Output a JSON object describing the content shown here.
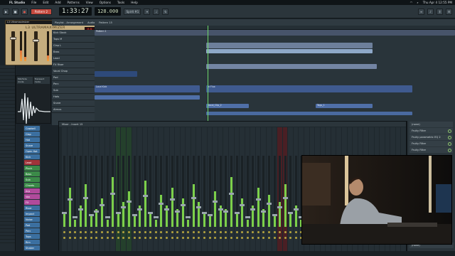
{
  "menubar": {
    "app": "FL Studio",
    "items": [
      "File",
      "Edit",
      "Add",
      "Patterns",
      "View",
      "Options",
      "Tools",
      "Help"
    ],
    "clock": "Thu Apr 4 12:55 PM"
  },
  "toolbar": {
    "pattern_label": "Pattern 2",
    "time": "1:33:27",
    "tempo": "128.000",
    "preset_box": "Spirit #1",
    "colors": {
      "pattern": "#c44a3f",
      "lcd": "#0b1012"
    }
  },
  "plugin": {
    "window_title": "L3 Ultramaximizer",
    "brand": "L3 ULTRAMAXIMIZER",
    "red_display": "0.0",
    "buttons": [
      "ARC",
      "Type",
      "Setup"
    ],
    "meter_levels": [
      0.35,
      0.15,
      0.2,
      0.42
    ],
    "fader_levels": [
      0.78,
      0.7,
      0.7,
      0.82
    ]
  },
  "wave_panel": {
    "tabs": [
      "Mid/Side mode",
      "Transient mode"
    ]
  },
  "playlist": {
    "header_items": [
      "Playlist - Arrangement",
      "Audio",
      "Pattern 15"
    ],
    "tracks": [
      "Kick Stack",
      "Tops M",
      "Clap L",
      "Bass",
      "Lead",
      "FX Riser",
      "Vocal Chop",
      "Pad",
      "Perc",
      "Sub",
      "Hats",
      "Snare",
      "Atmos"
    ],
    "clip_labels": [
      "Pattern 1",
      "Loud Kick",
      "In Flux",
      "Vocal_Clip_2",
      "Tags_1"
    ]
  },
  "channel_rack": {
    "channels": [
      {
        "name": "Cowbell",
        "color": "#3b6fa0"
      },
      {
        "name": "Clap",
        "color": "#3b6fa0"
      },
      {
        "name": "Hat",
        "color": "#3b6fa0"
      },
      {
        "name": "Snare",
        "color": "#3b6fa0"
      },
      {
        "name": "Open Hat",
        "color": "#3b6fa0"
      },
      {
        "name": "Kick",
        "color": "#3b6fa0"
      },
      {
        "name": "Lead",
        "color": "#a0343a"
      },
      {
        "name": "Pluck",
        "color": "#3b8a48"
      },
      {
        "name": "Bass",
        "color": "#3b8a48"
      },
      {
        "name": "Sub",
        "color": "#3b8a48"
      },
      {
        "name": "Chords",
        "color": "#3b8a48"
      },
      {
        "name": "Arp",
        "color": "#b04a9b"
      },
      {
        "name": "Vox",
        "color": "#b04a9b"
      },
      {
        "name": "FX",
        "color": "#b04a9b"
      },
      {
        "name": "Riser",
        "color": "#3b6fa0"
      },
      {
        "name": "Impact",
        "color": "#3b6fa0"
      },
      {
        "name": "Noise",
        "color": "#3b6fa0"
      },
      {
        "name": "Pad",
        "color": "#3b6fa0"
      },
      {
        "name": "Perc",
        "color": "#3b6fa0"
      },
      {
        "name": "Tops",
        "color": "#3b6fa0"
      },
      {
        "name": "Rim",
        "color": "#3b6fa0"
      },
      {
        "name": "Shaker",
        "color": "#3b6fa0"
      },
      {
        "name": "Tom",
        "color": "#3b6fa0"
      }
    ]
  },
  "mixer": {
    "title": "Mixer - Insert 15",
    "strip_count": 64,
    "strip_levels": [
      0.2,
      0.55,
      0.1,
      0.3,
      0.6,
      0.15,
      0.25,
      0.4,
      0.1,
      0.7,
      0.2,
      0.35,
      0.5,
      0.15,
      0.3,
      0.65,
      0.2,
      0.1,
      0.45,
      0.3,
      0.55,
      0.25,
      0.4,
      0.1,
      0.6,
      0.35,
      0.2,
      0.15,
      0.5,
      0.3,
      0.25,
      0.7,
      0.2,
      0.4,
      0.1,
      0.3,
      0.55,
      0.25,
      0.45,
      0.15,
      0.35,
      0.6,
      0.2,
      0.3,
      0.1,
      0.5,
      0.25,
      0.4,
      0.15,
      0.3,
      0.2,
      0.55,
      0.35,
      0.1,
      0.45,
      0.25,
      0.6,
      0.2,
      0.3,
      0.15,
      0.4,
      0.25,
      0.5,
      0.2
    ],
    "slots": [
      "(none)",
      "Fruity Filter",
      "Fruity parametric EQ 2",
      "Fruity Filter",
      "Fruity Filter"
    ],
    "bottom_slot": "(none)"
  }
}
